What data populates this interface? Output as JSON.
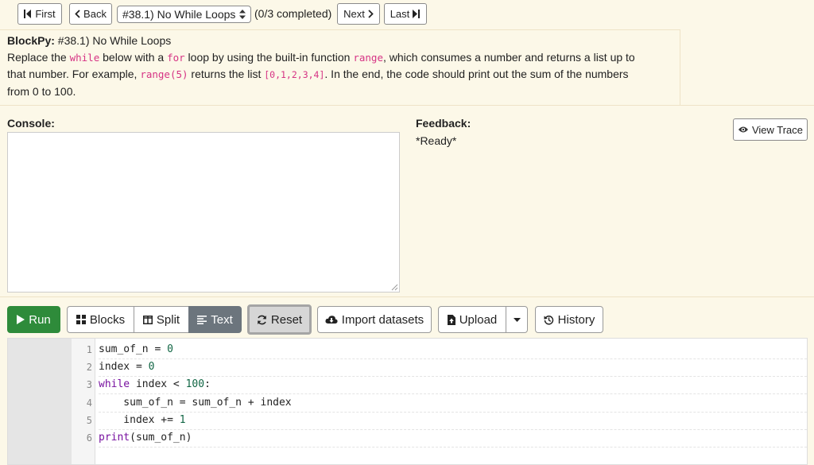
{
  "nav": {
    "first": "First",
    "back": "Back",
    "assignment_select": "#38.1) No While Loops",
    "progress": "(0/3 completed)",
    "next": "Next",
    "last": "Last"
  },
  "instructions": {
    "prefix": "BlockPy:",
    "title": " #38.1) No While Loops",
    "t1": "Replace the ",
    "c_while": "while",
    "t2": " below with a ",
    "c_for": "for",
    "t3": " loop by using the built-in function ",
    "c_range": "range",
    "t4": ", which consumes a number and returns a list up to",
    "t5": "that number. For example, ",
    "c_range5": "range(5)",
    "t6": " returns the list ",
    "c_list": "[0,1,2,3,4]",
    "t7": ". In the end, the code should print out the sum of the numbers",
    "t8": "from 0 to 100."
  },
  "console": {
    "label": "Console:"
  },
  "feedback": {
    "label": "Feedback:",
    "status": "*Ready*",
    "view_trace": "View Trace"
  },
  "toolbar": {
    "run": "Run",
    "blocks": "Blocks",
    "split": "Split",
    "text": "Text",
    "reset": "Reset",
    "import": "Import datasets",
    "upload": "Upload",
    "history": "History"
  },
  "editor": {
    "line_numbers": [
      "1",
      "2",
      "3",
      "4",
      "5",
      "6"
    ],
    "l1": {
      "a": "sum_of_n = ",
      "n": "0"
    },
    "l2": {
      "a": "index = ",
      "n": "0"
    },
    "l3": {
      "kw": "while",
      "a": " index < ",
      "n": "100",
      "b": ":"
    },
    "l4": {
      "a": "    sum_of_n = sum_of_n + index"
    },
    "l5": {
      "a": "    index += ",
      "n": "1"
    },
    "l6": {
      "kw": "print",
      "a": "(sum_of_n)"
    }
  },
  "colors": {
    "background": "#fcf8e8",
    "run_green": "#2e8b3a",
    "active_tab": "#6c757d",
    "code_pink": "#d63384",
    "keyword": "#77109f",
    "number": "#116644"
  }
}
